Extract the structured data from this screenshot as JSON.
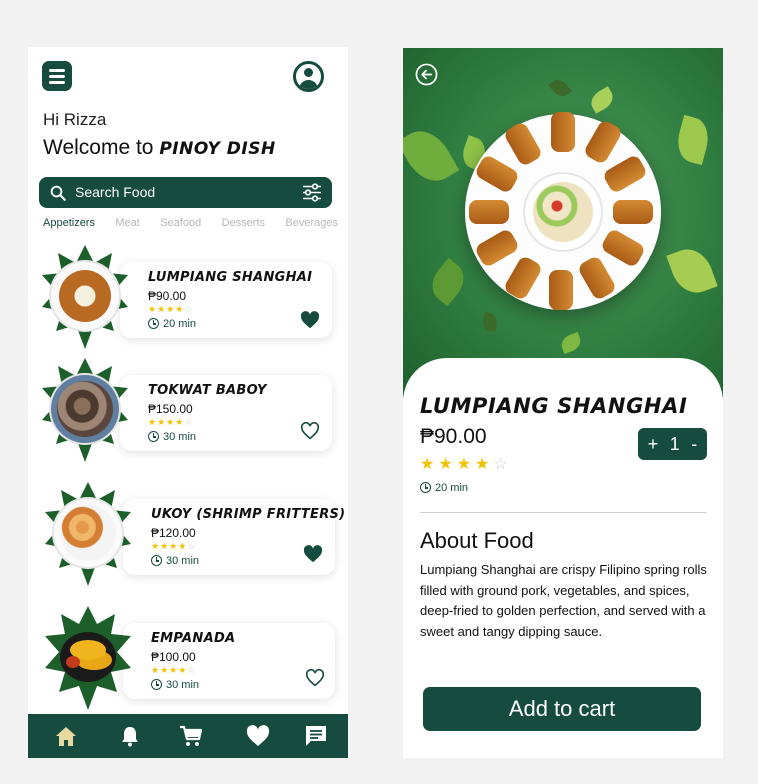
{
  "home": {
    "greeting": "Hi Rizza",
    "welcome_prefix": "Welcome to ",
    "brand": "PINOY DISH",
    "search": {
      "placeholder": "Search Food"
    },
    "categories": [
      {
        "label": "Appetizers",
        "active": true
      },
      {
        "label": "Meat",
        "active": false
      },
      {
        "label": "Seafood",
        "active": false
      },
      {
        "label": "Desserts",
        "active": false
      },
      {
        "label": "Beverages",
        "active": false
      }
    ],
    "items": [
      {
        "name": "LUMPIANG SHANGHAI",
        "price": "₱90.00",
        "rating": 4,
        "time": "20 min",
        "favorite": true
      },
      {
        "name": "TOKWAT BABOY",
        "price": "₱150.00",
        "rating": 4,
        "time": "30 min",
        "favorite": false
      },
      {
        "name": "UKOY (SHRIMP FRITTERS)",
        "price": "₱120.00",
        "rating": 4,
        "time": "30 min",
        "favorite": true
      },
      {
        "name": "EMPANADA",
        "price": "₱100.00",
        "rating": 4,
        "time": "30 min",
        "favorite": false
      }
    ],
    "nav": [
      "home-icon",
      "bell-icon",
      "cart-icon",
      "heart-icon",
      "chat-icon"
    ]
  },
  "detail": {
    "title": "LUMPIANG SHANGHAI",
    "price": "₱90.00",
    "rating": 4,
    "time": "20 min",
    "quantity": {
      "plus": "+",
      "value": "1",
      "minus": "-"
    },
    "about_title": "About Food",
    "about_text": "Lumpiang Shanghai are crispy Filipino spring rolls filled with ground pork, vegetables, and spices, deep-fried to golden perfection, and served with a sweet and tangy dipping sauce.",
    "add_to_cart": "Add to cart"
  },
  "colors": {
    "primary": "#164b3f",
    "star": "#f2c200",
    "background": "#f2f2f2"
  }
}
